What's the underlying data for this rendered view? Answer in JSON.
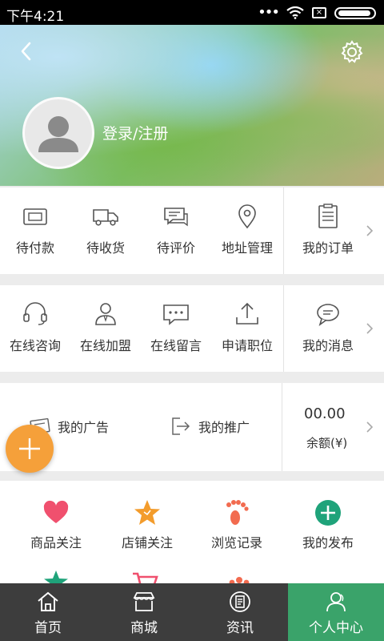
{
  "status_bar": {
    "time": "下午4:21",
    "dots": "•••",
    "sim_mark": "×"
  },
  "header": {
    "login_text": "登录/注册"
  },
  "orders_row": {
    "items": [
      {
        "label": "待付款",
        "icon": "wallet-icon"
      },
      {
        "label": "待收货",
        "icon": "truck-icon"
      },
      {
        "label": "待评价",
        "icon": "comment-icon"
      },
      {
        "label": "地址管理",
        "icon": "location-pin-icon"
      }
    ],
    "side": {
      "label": "我的订单",
      "icon": "order-list-icon"
    }
  },
  "service_row": {
    "items": [
      {
        "label": "在线咨询",
        "icon": "headset-icon"
      },
      {
        "label": "在线加盟",
        "icon": "person-icon"
      },
      {
        "label": "在线留言",
        "icon": "message-bubble-icon"
      },
      {
        "label": "申请职位",
        "icon": "upload-icon"
      }
    ],
    "side": {
      "label": "我的消息",
      "icon": "chat-icon"
    }
  },
  "promo_row": {
    "ads_label": "我的广告",
    "promote_label": "我的推广",
    "balance_amount": "00.00",
    "balance_label": "余额(¥)"
  },
  "favorites_row": {
    "items": [
      {
        "label": "商品关注",
        "icon": "heart-icon",
        "color": "#f0506e"
      },
      {
        "label": "店铺关注",
        "icon": "star-icon",
        "color": "#f39c2c"
      },
      {
        "label": "浏览记录",
        "icon": "footprint-icon",
        "color": "#f26b4f"
      },
      {
        "label": "我的发布",
        "icon": "plus-circle-icon",
        "color": "#1fa37a"
      }
    ]
  },
  "tab_bar": {
    "tabs": [
      {
        "label": "首页",
        "icon": "home-icon"
      },
      {
        "label": "商城",
        "icon": "store-icon"
      },
      {
        "label": "资讯",
        "icon": "news-icon"
      },
      {
        "label": "个人中心",
        "icon": "user-icon",
        "active": true
      }
    ]
  },
  "colors": {
    "fab": "#f5a03a",
    "active_tab": "#3aa36a",
    "tab_bar": "#3d3d3d"
  }
}
